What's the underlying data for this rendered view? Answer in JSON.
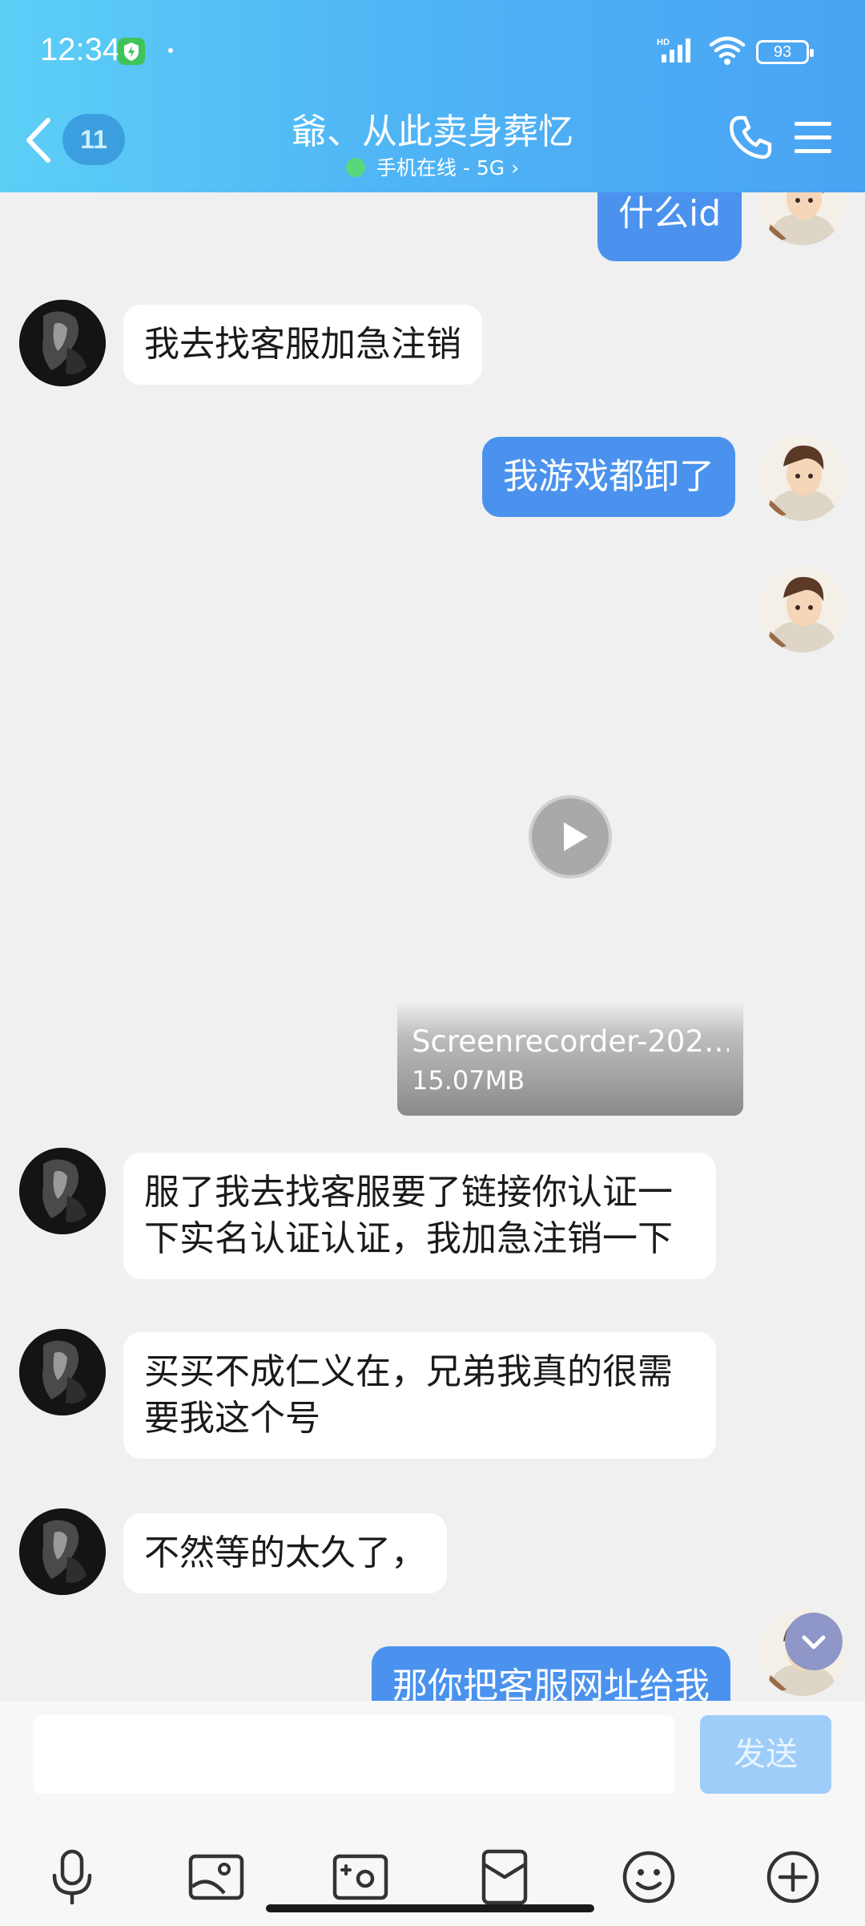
{
  "status_bar": {
    "time": "12:34",
    "battery": "93",
    "network_badge": "HD"
  },
  "header": {
    "back_badge": "11",
    "title": "爺、从此卖身葬忆",
    "subtitle": "手机在线 - 5G",
    "chevron": "›"
  },
  "messages": [
    {
      "from": "me",
      "text": "什么id"
    },
    {
      "from": "other",
      "text": "我去找客服加急注销"
    },
    {
      "from": "me",
      "text": "我游戏都卸了"
    },
    {
      "from": "me",
      "type": "video",
      "file_name": "Screenrecorder-202…",
      "file_size": "15.07MB"
    },
    {
      "from": "other",
      "text": "服了我去找客服要了链接你认证一下实名认证认证，我加急注销一下"
    },
    {
      "from": "other",
      "text": "买买不成仁义在，兄弟我真的很需要我这个号"
    },
    {
      "from": "other",
      "text": "不然等的太久了，"
    },
    {
      "from": "me",
      "text": "那你把客服网址给我"
    }
  ],
  "input_bar": {
    "placeholder": "",
    "send_label": "发送",
    "tools": [
      "microphone-icon",
      "image-icon",
      "camera-icon",
      "red-packet-icon",
      "emoji-icon",
      "plus-icon"
    ]
  },
  "colors": {
    "header_start": "#5ccff6",
    "header_end": "#4aa3f3",
    "my_bubble": "#4a92ee",
    "send_button": "#9fcdfa",
    "online_dot": "#5ad77a"
  }
}
